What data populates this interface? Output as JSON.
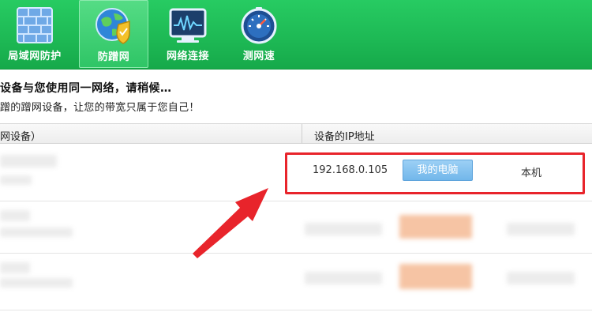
{
  "toolbar": {
    "items": [
      {
        "label": "局域网防护",
        "icon": "brick-wall-icon",
        "active": false
      },
      {
        "label": "防蹭网",
        "icon": "globe-shield-icon",
        "active": true
      },
      {
        "label": "网络连接",
        "icon": "network-monitor-icon",
        "active": false
      },
      {
        "label": "测网速",
        "icon": "speedometer-icon",
        "active": false
      }
    ]
  },
  "info": {
    "line1": "设备与您使用同一网络，请稍候…",
    "line2": "蹭的蹭网设备，让您的带宽只属于您自己！"
  },
  "table": {
    "col_device": "网设备）",
    "col_ip": "设备的IP地址",
    "rows": [
      {
        "ip": "192.168.0.105",
        "button": "我的电脑",
        "tag": "本机"
      }
    ]
  },
  "colors": {
    "toolbar_green": "#1db854",
    "highlight_red": "#e8242b",
    "button_blue": "#72b7ea"
  }
}
